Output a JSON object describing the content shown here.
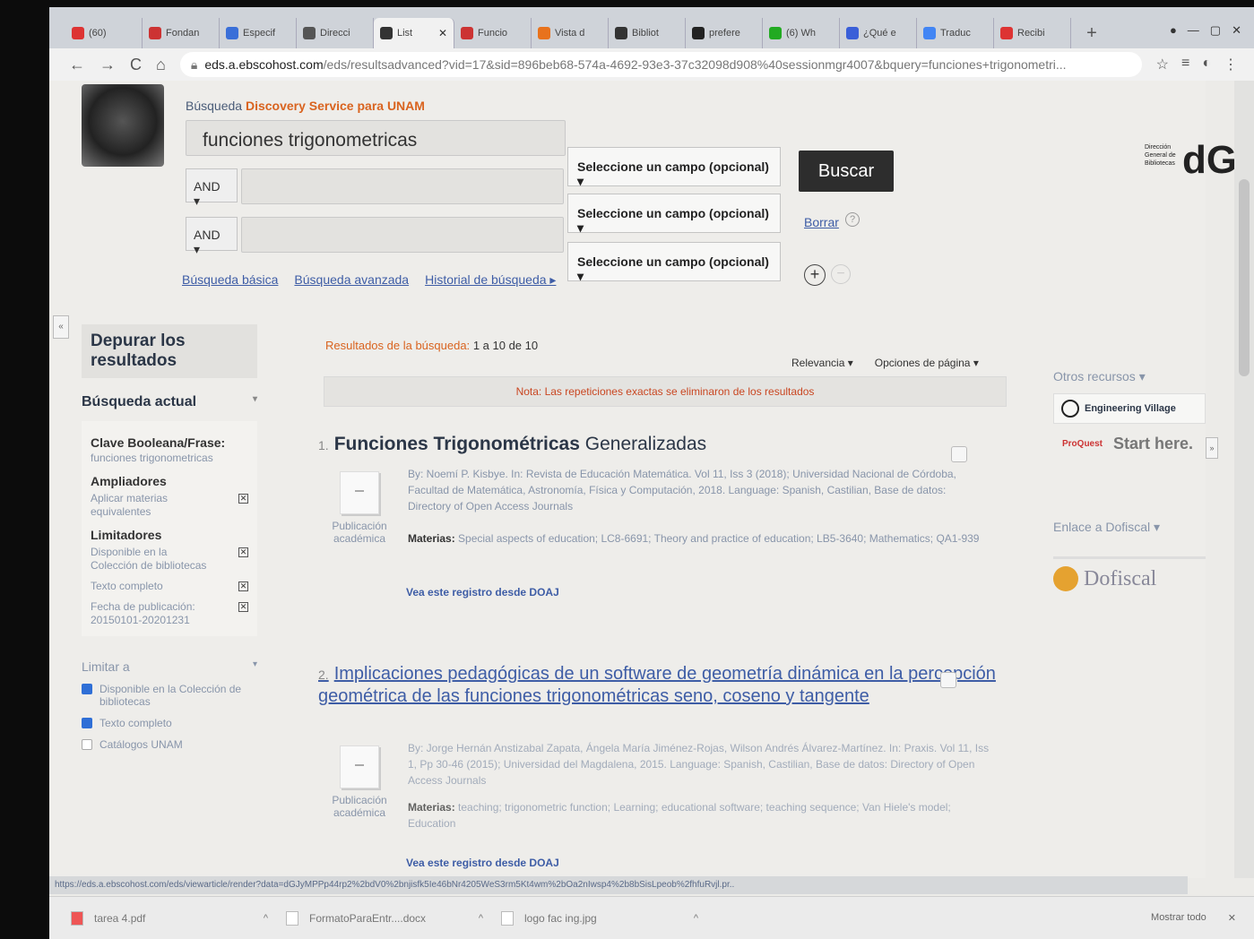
{
  "browser": {
    "tabs": [
      {
        "label": "(60)",
        "color": "#d33"
      },
      {
        "label": "Fondan",
        "color": "#c33"
      },
      {
        "label": "Especif",
        "color": "#3a6fd8"
      },
      {
        "label": "Direcci",
        "color": "#555"
      },
      {
        "label": "List",
        "color": "#333",
        "active": true
      },
      {
        "label": "Funcio",
        "color": "#c33"
      },
      {
        "label": "Vista d",
        "color": "#e8721c"
      },
      {
        "label": "Bibliot",
        "color": "#333"
      },
      {
        "label": "prefere",
        "color": "#222"
      },
      {
        "label": "(6) Wh",
        "color": "#2a2"
      },
      {
        "label": "¿Qué e",
        "color": "#3a5fd8"
      },
      {
        "label": "Traduc",
        "color": "#4285f4"
      },
      {
        "label": "Recibi",
        "color": "#d33"
      }
    ],
    "url_host": "eds.a.ebscohost.com",
    "url_path": "/eds/resultsadvanced?vid=17&sid=896beb68-574a-4692-93e3-37c32098d908%40sessionmgr4007&bquery=funciones+trigonometri..."
  },
  "header": {
    "brand_prefix": "Búsqueda",
    "brand_highlight": "Discovery Service para UNAM",
    "query": "funciones trigonometricas",
    "bool_1": "AND ▾",
    "bool_2": "AND ▾",
    "field_1": "Seleccione un campo (opcional) ▾",
    "field_2": "Seleccione un campo (opcional) ▾",
    "field_3": "Seleccione un campo (opcional) ▾",
    "search_button": "Buscar",
    "clear": "Borrar",
    "help": "?",
    "add": "+",
    "remove": "−",
    "links": [
      "Búsqueda básica",
      "Búsqueda avanzada",
      "Historial de búsqueda ▸"
    ],
    "dgb_text": "Dirección General de Bibliotecas",
    "dgb_logo": "dGB"
  },
  "sidebar": {
    "collapse": "«",
    "title": "Depurar los resultados",
    "current": "Búsqueda actual",
    "current_chevron": "▾",
    "key_label": "Clave Booleana/Frase:",
    "key_value": "funciones trigonometricas",
    "expanders_label": "Ampliadores",
    "expander_1": "Aplicar materias equivalentes",
    "limiters_label": "Limitadores",
    "limiter_1": "Disponible en la Colección de bibliotecas",
    "limiter_2": "Texto completo",
    "limiter_3": "Fecha de publicación: 20150101-20201231",
    "limit_to": "Limitar a",
    "limit_chevron": "▾",
    "check_1": "Disponible en la Colección de bibliotecas",
    "check_2": "Texto completo",
    "check_3": "Catálogos UNAM"
  },
  "results": {
    "label": "Resultados de la búsqueda:",
    "range": "1 a 10 de 10",
    "sort": "Relevancia ▾",
    "page_options": "Opciones de página ▾",
    "note": "Nota: Las repeticiones exactas se eliminaron de los resultados",
    "items": [
      {
        "num": "1.",
        "title_bold": "Funciones Trigonométricas",
        "title_rest": " Generalizadas",
        "type": "Publicación académica",
        "byline": "By: Noemí P. Kisbye. In: Revista de Educación Matemática. Vol 11, Iss 3 (2018); Universidad Nacional de Córdoba, Facultad de Matemática, Astronomía, Física y Computación, 2018. Language: Spanish, Castilian, Base de datos: Directory of Open Access Journals",
        "subjects_label": "Materias:",
        "subjects": " Special aspects of education; LC8-6691; Theory and practice of education; LB5-3640; Mathematics; QA1-939",
        "link": "Vea este registro desde DOAJ"
      },
      {
        "num": "2.",
        "title": "Implicaciones pedagógicas de un software de geometría dinámica en la percepción geométrica de las funciones trigonométricas seno, coseno y tangente",
        "type": "Publicación académica",
        "byline": "By: Jorge Hernán Anstizabal Zapata, Ángela María Jiménez-Rojas, Wilson Andrés Álvarez-Martínez. In: Praxis. Vol 11, Iss 1, Pp 30-46 (2015); Universidad del Magdalena, 2015. Language: Spanish, Castilian, Base de datos: Directory of Open Access Journals",
        "subjects_label": "Materias:",
        "subjects": " teaching; trigonometric function; Learning; educational software; teaching sequence; Van Hiele's model; Education",
        "link": "Vea este registro desde DOAJ"
      }
    ]
  },
  "right": {
    "other": "Otros recursos ▾",
    "engineering": "Engineering Village",
    "proquest": "ProQuest",
    "start": "Start here.",
    "dofiscal_link": "Enlace a Dofiscal ▾",
    "dofiscal": "Dofiscal",
    "collapse": "»"
  },
  "status_url": "https://eds.a.ebscohost.com/eds/viewarticle/render?data=dGJyMPPp44rp2%2bdV0%2bnjisfk5Ie46bNr4205WeS3rm5Kt4wm%2bOa2nIwsp4%2b8bSisLpeob%2fhfuRvjl.pr..",
  "downloads": [
    {
      "name": "tarea 4.pdf",
      "pdf": true
    },
    {
      "name": "FormatoParaEntr....docx",
      "pdf": false
    },
    {
      "name": "logo fac ing.jpg",
      "pdf": false
    }
  ],
  "downloads_show_all": "Mostrar todo",
  "downloads_close": "✕"
}
